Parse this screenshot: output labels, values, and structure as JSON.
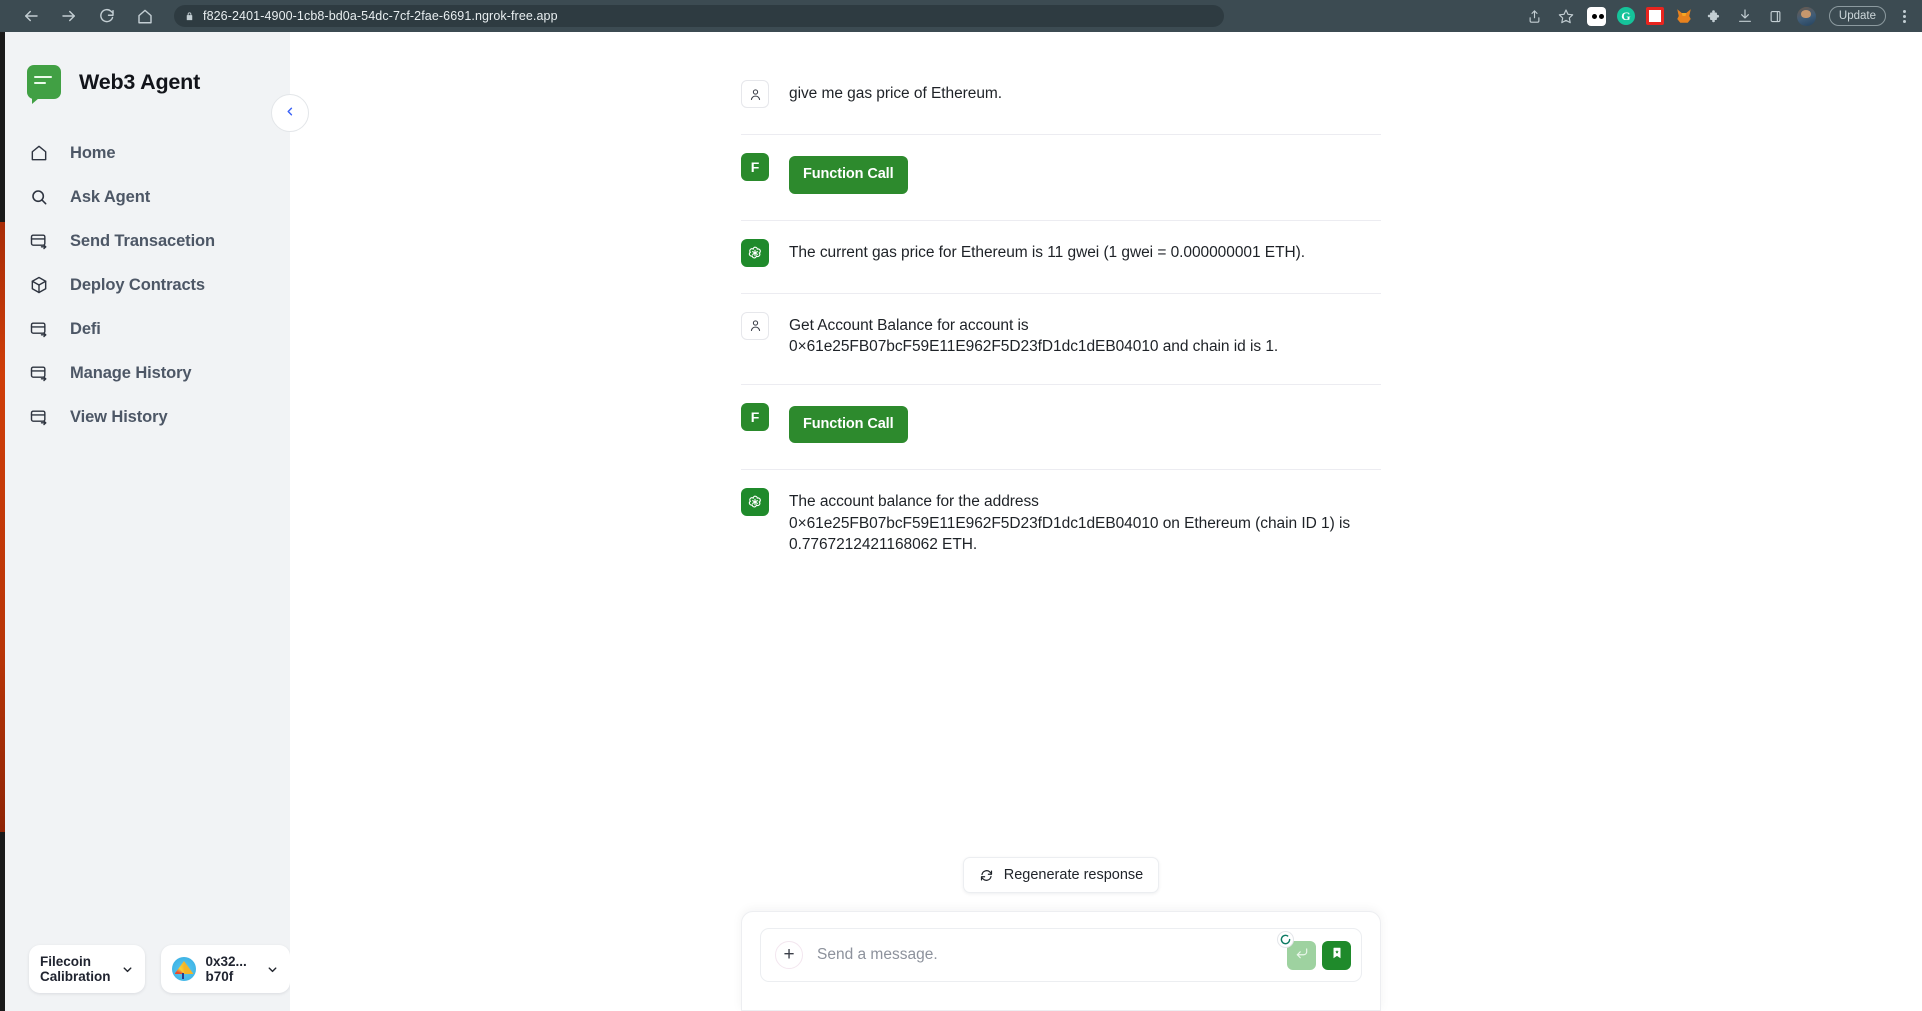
{
  "browser": {
    "url": "f826-2401-4900-1cb8-bd0a-54dc-7cf-2fae-6691.ngrok-free.app",
    "back_icon": "arrow-left-icon",
    "forward_icon": "arrow-right-icon",
    "reload_icon": "reload-icon",
    "home_icon": "home-icon",
    "lock_icon": "lock-icon",
    "share_icon": "share-icon",
    "bookmark_icon": "star-icon",
    "update_label": "Update",
    "extensions": [
      "dice-extension-icon",
      "grammarly-extension-icon",
      "redpaw-extension-icon",
      "metamask-fox-icon",
      "puzzle-extensions-icon",
      "downloads-icon",
      "sidepanel-icon"
    ],
    "profile_avatar": "profile-avatar",
    "menu_icon": "kebab-menu-icon",
    "chrome_bg": "#3c4b52",
    "omnibox_bg": "#2e3b41"
  },
  "sidebar": {
    "brand": "Web3 Agent",
    "logo_icon": "chat-bubble-logo-icon",
    "collapse_icon": "chevron-left-icon",
    "accent": "#41a044",
    "items": [
      {
        "label": "Home",
        "icon": "home-icon"
      },
      {
        "label": "Ask Agent",
        "icon": "search-icon"
      },
      {
        "label": "Send Transacetion",
        "icon": "card-send-icon"
      },
      {
        "label": "Deploy Contracts",
        "icon": "cube-icon"
      },
      {
        "label": "Defi",
        "icon": "card-send-icon"
      },
      {
        "label": "Manage History",
        "icon": "card-send-icon"
      },
      {
        "label": "View History",
        "icon": "card-send-icon"
      }
    ],
    "footer": {
      "network_label": "Filecoin Calibration",
      "network_caret_icon": "chevron-down-icon",
      "wallet_label": "0x32... b70f",
      "wallet_avatar": "wallet-avatar",
      "wallet_caret_icon": "chevron-down-icon"
    }
  },
  "chat": {
    "messages": [
      {
        "role": "user",
        "avatar_icon": "user-avatar-icon",
        "text": "give me gas price of Ethereum."
      },
      {
        "role": "function",
        "avatar_label": "F",
        "badge_label": "Function Call"
      },
      {
        "role": "assistant",
        "avatar_icon": "openai-logo-icon",
        "text": "The current gas price for Ethereum is 11 gwei (1 gwei = 0.000000001 ETH)."
      },
      {
        "role": "user",
        "avatar_icon": "user-avatar-icon",
        "text": "Get Account Balance for account is 0×61e25FB07bcF59E11E962F5D23fD1dc1dEB04010 and chain id is 1."
      },
      {
        "role": "function",
        "avatar_label": "F",
        "badge_label": "Function Call"
      },
      {
        "role": "assistant",
        "avatar_icon": "openai-logo-icon",
        "text": "The account balance for the address 0×61e25FB07bcF59E11E962F5D23fD1dc1dEB04010 on Ethereum (chain ID 1) is 0.7767212421168062 ETH."
      }
    ]
  },
  "composer": {
    "regenerate_label": "Regenerate response",
    "regenerate_icon": "refresh-icon",
    "add_icon": "plus-icon",
    "placeholder": "Send a message.",
    "input_value": "",
    "enter_icon": "enter-arrow-icon",
    "save_icon": "bookmark-icon",
    "spinner_icon": "loading-spinner-icon",
    "enter_color": "#9ed2a0",
    "save_color": "#1f8a2b"
  }
}
